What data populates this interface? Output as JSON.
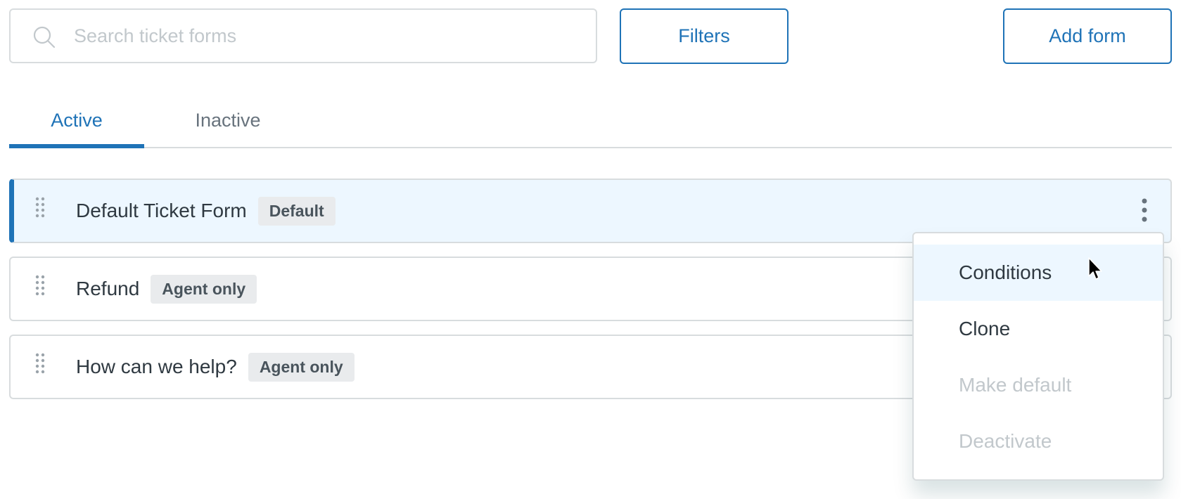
{
  "search": {
    "placeholder": "Search ticket forms",
    "value": "",
    "icon": "search-icon"
  },
  "toolbar": {
    "filters_label": "Filters",
    "add_label": "Add form"
  },
  "tabs": [
    {
      "label": "Active",
      "selected": true
    },
    {
      "label": "Inactive",
      "selected": false
    }
  ],
  "forms": [
    {
      "name": "Default Ticket Form",
      "badge": "Default",
      "selected": true
    },
    {
      "name": "Refund",
      "badge": "Agent only",
      "selected": false
    },
    {
      "name": "How can we help?",
      "badge": "Agent only",
      "selected": false
    }
  ],
  "menu": {
    "items": [
      {
        "label": "Conditions",
        "state": "hover"
      },
      {
        "label": "Clone",
        "state": "enabled"
      },
      {
        "label": "Make default",
        "state": "disabled"
      },
      {
        "label": "Deactivate",
        "state": "disabled"
      }
    ]
  },
  "colors": {
    "accent": "#1f73b7",
    "selected_row_bg": "#edf7ff",
    "border": "#d8dcde",
    "badge_bg": "#e9ebed",
    "disabled_text": "#c2c8cc"
  }
}
